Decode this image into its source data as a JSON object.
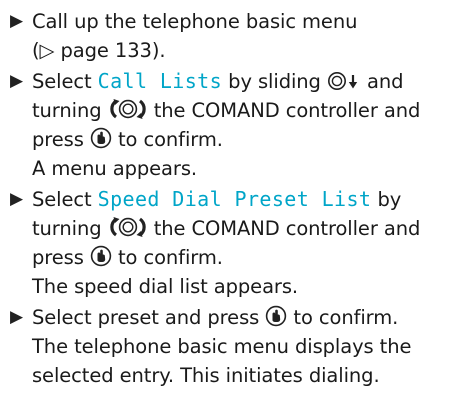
{
  "colors": {
    "text": "#1a1a1a",
    "highlight": "#00a5c8"
  },
  "icons": {
    "bullet": "triangle-right-icon",
    "slide_down": "controller-slide-down-icon",
    "turn": "controller-turn-icon",
    "press": "controller-press-icon"
  },
  "steps": [
    {
      "lines": [
        "Call up the telephone basic menu",
        "(▷ page 133)."
      ]
    },
    {
      "line1_prefix": "Select ",
      "line1_term": "Call Lists",
      "line1_suffix": " by sliding ",
      "line2_prefix": "turning ",
      "line2_suffix": " the COMAND controller and",
      "line3_prefix": "press ",
      "line3_suffix": " to confirm.",
      "result": "A menu appears."
    },
    {
      "line1_prefix": "Select ",
      "line1_term": "Speed Dial Preset List",
      "line1_suffix": " by",
      "line2_prefix": "turning ",
      "line2_suffix": " the COMAND controller and",
      "line3_prefix": "press ",
      "line3_suffix": " to confirm.",
      "result": "The speed dial list appears."
    },
    {
      "line1_prefix": "Select preset and press ",
      "line1_suffix": " to confirm.",
      "result_lines": [
        "The telephone basic menu displays the",
        "selected entry. This initiates dialing."
      ]
    }
  ]
}
